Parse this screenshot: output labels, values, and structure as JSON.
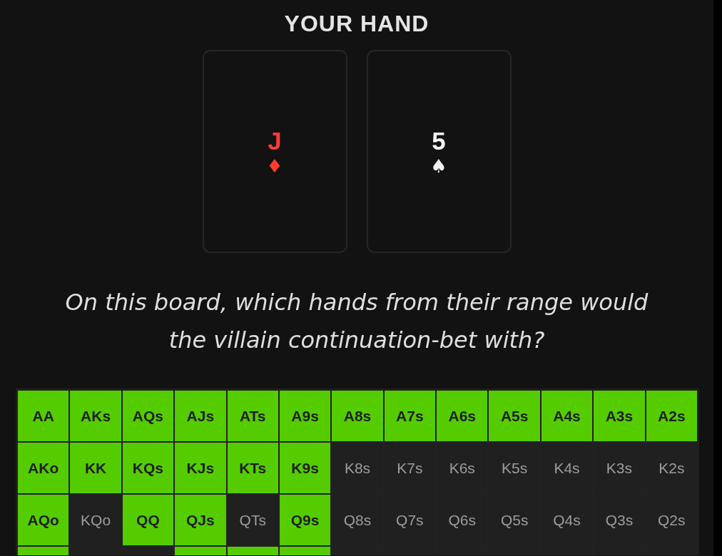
{
  "title": "YOUR HAND",
  "cards": [
    {
      "rank": "J",
      "suit": "♦",
      "color": "#ff3b30"
    },
    {
      "rank": "5",
      "suit": "♠",
      "color": "#f2f2f2"
    }
  ],
  "question": "On this board, which hands from their range would the villain continuation-bet with?",
  "range_grid": {
    "rows": [
      {
        "cells": [
          {
            "label": "AA",
            "selected": true
          },
          {
            "label": "AKs",
            "selected": true
          },
          {
            "label": "AQs",
            "selected": true
          },
          {
            "label": "AJs",
            "selected": true
          },
          {
            "label": "ATs",
            "selected": true
          },
          {
            "label": "A9s",
            "selected": true
          },
          {
            "label": "A8s",
            "selected": true
          },
          {
            "label": "A7s",
            "selected": true
          },
          {
            "label": "A6s",
            "selected": true
          },
          {
            "label": "A5s",
            "selected": true
          },
          {
            "label": "A4s",
            "selected": true
          },
          {
            "label": "A3s",
            "selected": true
          },
          {
            "label": "A2s",
            "selected": true
          }
        ]
      },
      {
        "cells": [
          {
            "label": "AKo",
            "selected": true
          },
          {
            "label": "KK",
            "selected": true
          },
          {
            "label": "KQs",
            "selected": true
          },
          {
            "label": "KJs",
            "selected": true
          },
          {
            "label": "KTs",
            "selected": true
          },
          {
            "label": "K9s",
            "selected": true
          },
          {
            "label": "K8s",
            "selected": false
          },
          {
            "label": "K7s",
            "selected": false
          },
          {
            "label": "K6s",
            "selected": false
          },
          {
            "label": "K5s",
            "selected": false
          },
          {
            "label": "K4s",
            "selected": false
          },
          {
            "label": "K3s",
            "selected": false
          },
          {
            "label": "K2s",
            "selected": false
          }
        ]
      },
      {
        "cells": [
          {
            "label": "AQo",
            "selected": true
          },
          {
            "label": "KQo",
            "selected": false
          },
          {
            "label": "QQ",
            "selected": true
          },
          {
            "label": "QJs",
            "selected": true
          },
          {
            "label": "QTs",
            "selected": false
          },
          {
            "label": "Q9s",
            "selected": true
          },
          {
            "label": "Q8s",
            "selected": false
          },
          {
            "label": "Q7s",
            "selected": false
          },
          {
            "label": "Q6s",
            "selected": false
          },
          {
            "label": "Q5s",
            "selected": false
          },
          {
            "label": "Q4s",
            "selected": false
          },
          {
            "label": "Q3s",
            "selected": false
          },
          {
            "label": "Q2s",
            "selected": false
          }
        ]
      },
      {
        "cells": [
          {
            "selected": true
          },
          {
            "selected": false
          },
          {
            "selected": false
          },
          {
            "selected": true
          },
          {
            "selected": true
          },
          {
            "selected": true
          },
          {
            "selected": false
          },
          {
            "selected": false
          },
          {
            "selected": false
          },
          {
            "selected": false
          },
          {
            "selected": false
          },
          {
            "selected": false
          },
          {
            "selected": false
          }
        ]
      }
    ]
  }
}
